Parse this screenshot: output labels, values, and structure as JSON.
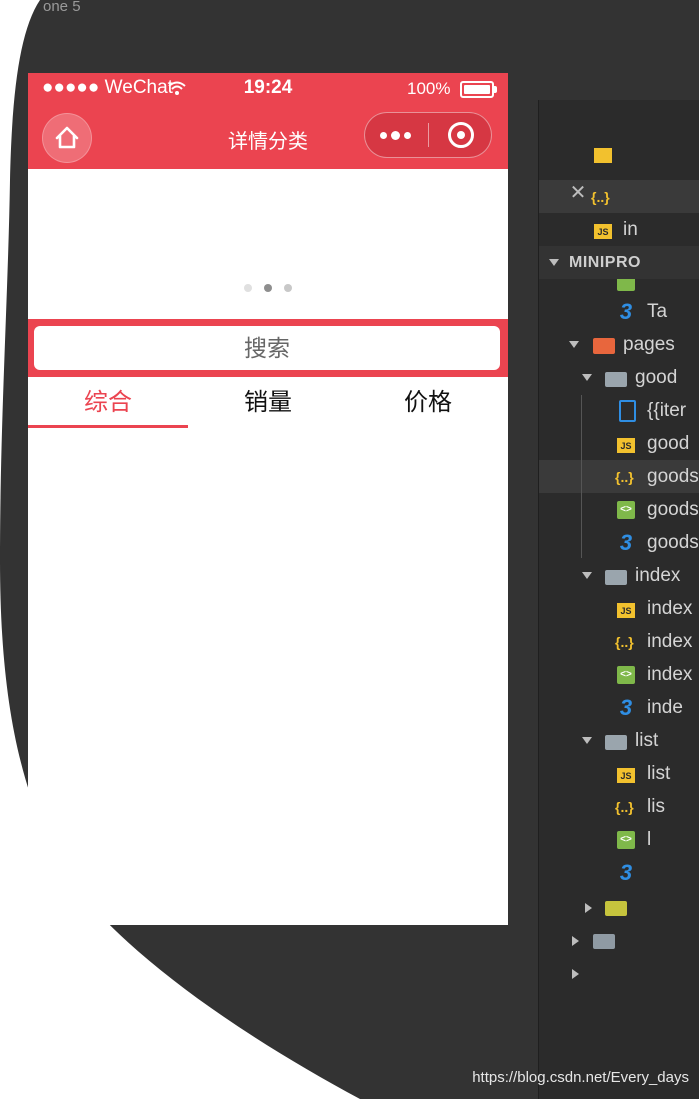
{
  "backdrop_color": "#333333",
  "accent_color": "#eb4450",
  "corner_text": "one 5",
  "status_bar": {
    "signal": "●●●●● WeChat",
    "time": "19:24",
    "battery": "100%"
  },
  "nav_bar": {
    "title": "详情分类",
    "home_icon": "home-icon",
    "more_icon": "more-dots-icon",
    "close_icon": "target-close-icon"
  },
  "swiper": {
    "dot_count": 3,
    "active_index": 1
  },
  "search": {
    "placeholder": "搜索"
  },
  "tabs": [
    {
      "label": "综合",
      "active": true
    },
    {
      "label": "销量",
      "active": false
    },
    {
      "label": "价格",
      "active": false
    }
  ],
  "ide_tree": [
    {
      "label": "in",
      "icon": "js",
      "badge": "JS"
    },
    {
      "label": "MINIPRO",
      "icon": "section"
    },
    {
      "label": "Ta",
      "icon": "wxss",
      "badge": "3"
    },
    {
      "label": "pages",
      "icon": "folder-pages"
    },
    {
      "label": "good",
      "icon": "folder-open"
    },
    {
      "label": "{{iter",
      "icon": "file"
    },
    {
      "label": "good",
      "icon": "js",
      "badge": "JS"
    },
    {
      "label": "goods",
      "icon": "json",
      "badge": "{..}"
    },
    {
      "label": "goods",
      "icon": "wxml",
      "badge": "<>"
    },
    {
      "label": "goods",
      "icon": "wxss",
      "badge": "3"
    },
    {
      "label": "index",
      "icon": "folder-open"
    },
    {
      "label": "index",
      "icon": "js",
      "badge": "JS"
    },
    {
      "label": "index",
      "icon": "json",
      "badge": "{..}"
    },
    {
      "label": "index",
      "icon": "wxml",
      "badge": "<>"
    },
    {
      "label": "inde",
      "icon": "wxss",
      "badge": "3"
    },
    {
      "label": "list",
      "icon": "folder-open"
    },
    {
      "label": "list",
      "icon": "js",
      "badge": "JS"
    },
    {
      "label": "lis",
      "icon": "json",
      "badge": "{..}"
    },
    {
      "label": "l",
      "icon": "wxml",
      "badge": "<>"
    }
  ],
  "ide_tab_badge": "{..}",
  "ide_tab_close": "✕",
  "watermark": "https://blog.csdn.net/Every_days"
}
